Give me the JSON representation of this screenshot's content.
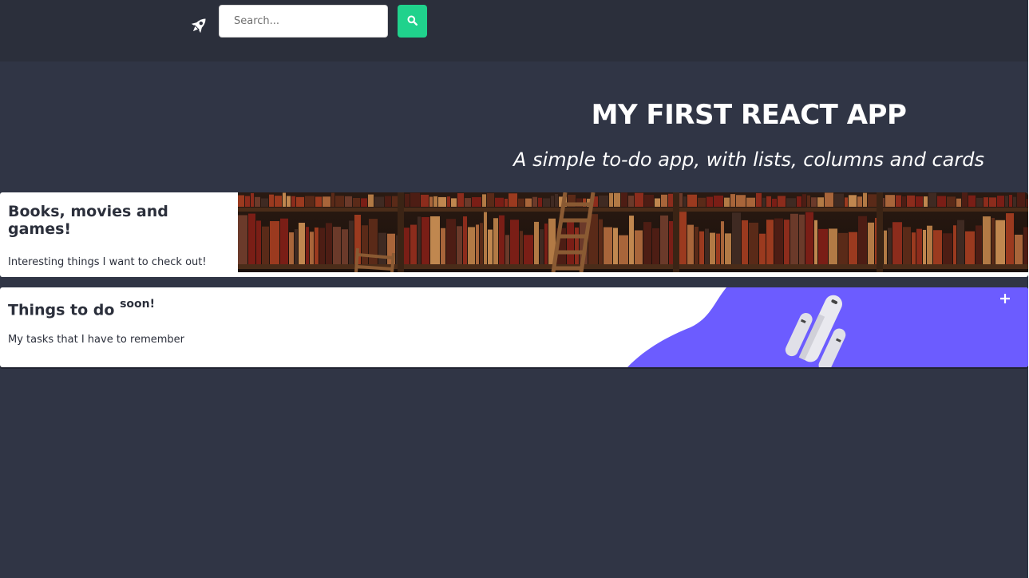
{
  "navbar": {
    "logo_icon": "rocket-icon",
    "search": {
      "placeholder": "Search...",
      "value": ""
    },
    "search_button_icon": "search-icon",
    "accent_color": "#20d28c"
  },
  "hero": {
    "title": "MY FIRST REACT APP",
    "subtitle": "A simple to-do app, with lists, columns and cards"
  },
  "lists": [
    {
      "title": "Books, movies and games!",
      "badge": "",
      "description": "Interesting things I want to check out!",
      "banner": "bookshelf-image"
    },
    {
      "title": "Things to do",
      "badge": "soon!",
      "description": "My tasks that I have to remember",
      "banner": "rocket-illustration",
      "banner_color": "#6c5cff",
      "add_icon": "plus-icon"
    }
  ],
  "colors": {
    "background": "#303545",
    "navbar": "#2b2f3b"
  }
}
